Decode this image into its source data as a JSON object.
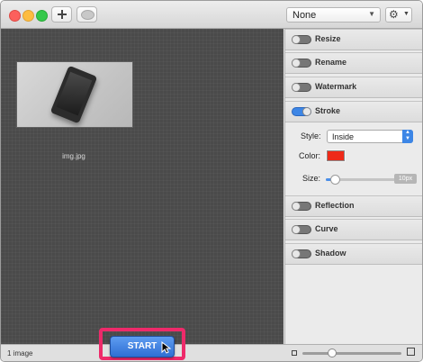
{
  "toolbar": {
    "add_icon": "plus-icon",
    "preview_icon": "eye-icon",
    "preset": "None",
    "gear_icon": "gear-icon"
  },
  "canvas": {
    "items": [
      {
        "filename": "img.jpg"
      }
    ]
  },
  "sidebar": {
    "sections": {
      "resize": {
        "label": "Resize",
        "enabled": false
      },
      "rename": {
        "label": "Rename",
        "enabled": false
      },
      "watermark": {
        "label": "Watermark",
        "enabled": false
      },
      "stroke": {
        "label": "Stroke",
        "enabled": true,
        "style_label": "Style:",
        "style_value": "Inside",
        "color_label": "Color:",
        "color_value": "#ee2a19",
        "size_label": "Size:",
        "size_value": "10px",
        "size_level": 0.12
      },
      "reflection": {
        "label": "Reflection",
        "enabled": false
      },
      "curve": {
        "label": "Curve",
        "enabled": false
      },
      "shadow": {
        "label": "Shadow",
        "enabled": false
      }
    }
  },
  "statusbar": {
    "count": "1 image",
    "zoom_level": 0.3
  },
  "start_button": {
    "label": "START",
    "highlight_color": "#ee2a6a"
  }
}
